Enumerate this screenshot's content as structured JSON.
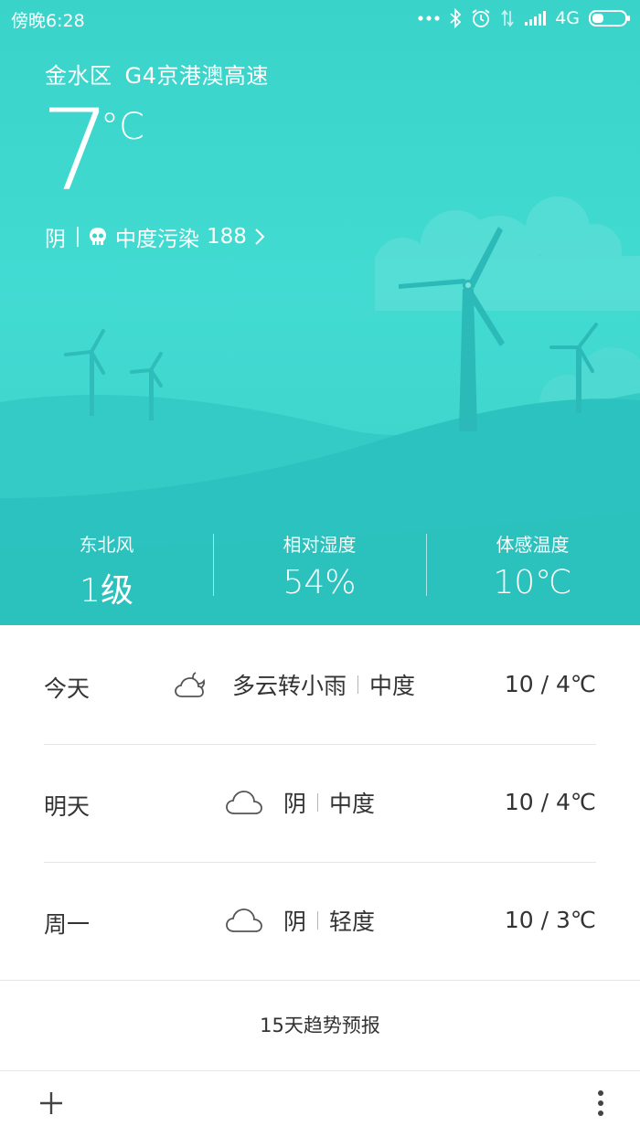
{
  "status_bar": {
    "time": "傍晚6:28",
    "network": "4G",
    "icons": [
      "dots-icon",
      "bluetooth-icon",
      "alarm-icon",
      "data-arrows-icon",
      "signal-icon",
      "battery-icon"
    ]
  },
  "location": {
    "district": "金水区",
    "road": "G4京港澳高速"
  },
  "current": {
    "temperature": "7",
    "unit": "°C",
    "condition": "阴",
    "pollution_label": "中度污染",
    "aqi": "188"
  },
  "stats": [
    {
      "label": "东北风",
      "value": "1级"
    },
    {
      "label": "相对湿度",
      "value": "54%"
    },
    {
      "label": "体感温度",
      "value": "10℃"
    }
  ],
  "forecast": [
    {
      "day": "今天",
      "icon": "cloud-moon-icon",
      "condition": "多云转小雨",
      "air": "中度",
      "range": "10 / 4℃"
    },
    {
      "day": "明天",
      "icon": "cloud-icon",
      "condition": "阴",
      "air": "中度",
      "range": "10 / 4℃"
    },
    {
      "day": "周一",
      "icon": "cloud-icon",
      "condition": "阴",
      "air": "轻度",
      "range": "10 / 3℃"
    }
  ],
  "trend_link": "15天趋势预报",
  "colors": {
    "sky": "#3fd6cd",
    "hill": "#2fc2bf",
    "text_dark": "#333333"
  }
}
